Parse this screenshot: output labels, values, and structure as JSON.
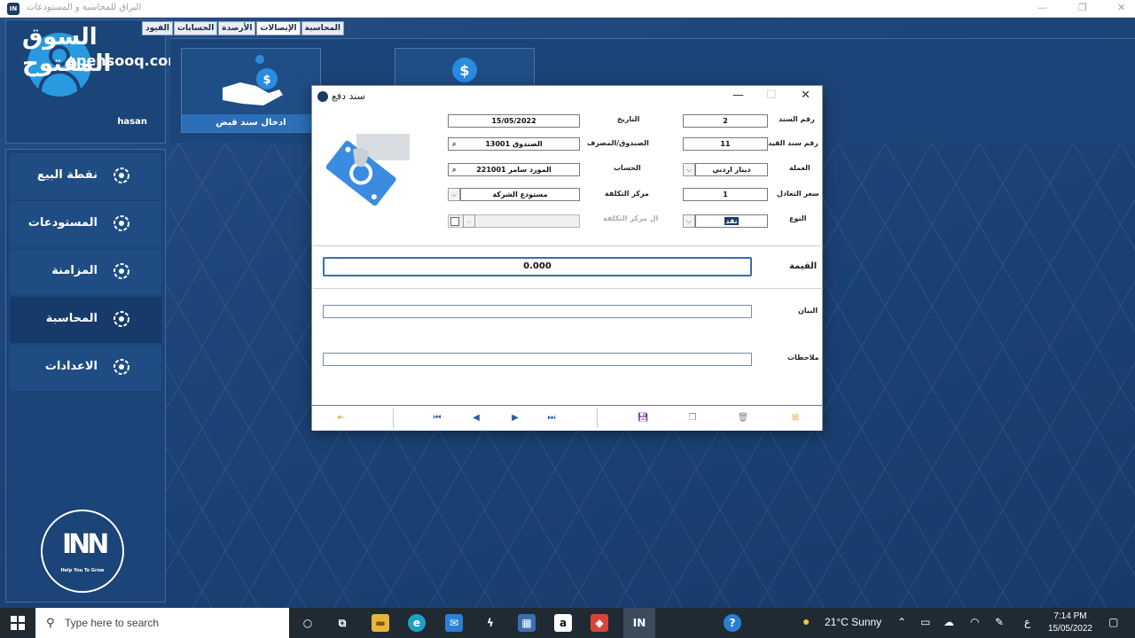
{
  "app": {
    "title": "البراق للمحاسبة و المستودعات",
    "watermark_ar": "السوق المفتوح",
    "watermark_en": "opensooq.com",
    "user_name": "hasan",
    "tabs": [
      "المحاسبة",
      "الإيصالات",
      "الأرصدة",
      "الحسابات",
      "القيود"
    ],
    "active_tab": "الإيصالات",
    "tiles": [
      {
        "label": "ادخال سند قبض",
        "icon": "hand-dollar-icon"
      },
      {
        "label": "",
        "icon": "dollar-coin-icon"
      }
    ],
    "sidebar": [
      {
        "label": "نقطة البيع",
        "icon": "swirl-icon"
      },
      {
        "label": "المستودعات",
        "icon": "swirl-icon"
      },
      {
        "label": "المزامنة",
        "icon": "swirl-icon"
      },
      {
        "label": "المحاسبة",
        "icon": "swirl-icon",
        "selected": true
      },
      {
        "label": "الاعدادات",
        "icon": "swirl-icon"
      }
    ],
    "brand": {
      "mark": "INN",
      "tagline": "Help You To Grow"
    }
  },
  "dialog": {
    "title": "سند دفع",
    "fields": {
      "voucher_no": {
        "label": "رقم السند",
        "value": "2"
      },
      "entry_no": {
        "label": "رقم سند القيد",
        "value": "11"
      },
      "currency": {
        "label": "العملة",
        "value": "دينار اردني"
      },
      "exchange_rate": {
        "label": "سعر التعادل",
        "value": "1"
      },
      "type": {
        "label": "النوع",
        "value": "نقد"
      },
      "date": {
        "label": "التاريخ",
        "value": "15/05/2022"
      },
      "cashbox": {
        "label": "الصندوق/المصرف",
        "value": "13001 الصندوق"
      },
      "account": {
        "label": "الحساب",
        "value": "221001 المورد سامر"
      },
      "cost_center": {
        "label": "مركز التكلفة",
        "value": "مستودع الشركة"
      },
      "cost_center_2": {
        "label": "ال مركز التكلفة",
        "value": ""
      }
    },
    "value_label": "القيمة",
    "value": "0.000",
    "statement_label": "البيان",
    "statement_value": "",
    "notes_label": "ملاحظات",
    "notes_value": ""
  },
  "taskbar": {
    "search_placeholder": "Type here to search",
    "weather": "21°C  Sunny",
    "lang": "ع",
    "time": "7:14 PM",
    "date": "15/05/2022"
  }
}
